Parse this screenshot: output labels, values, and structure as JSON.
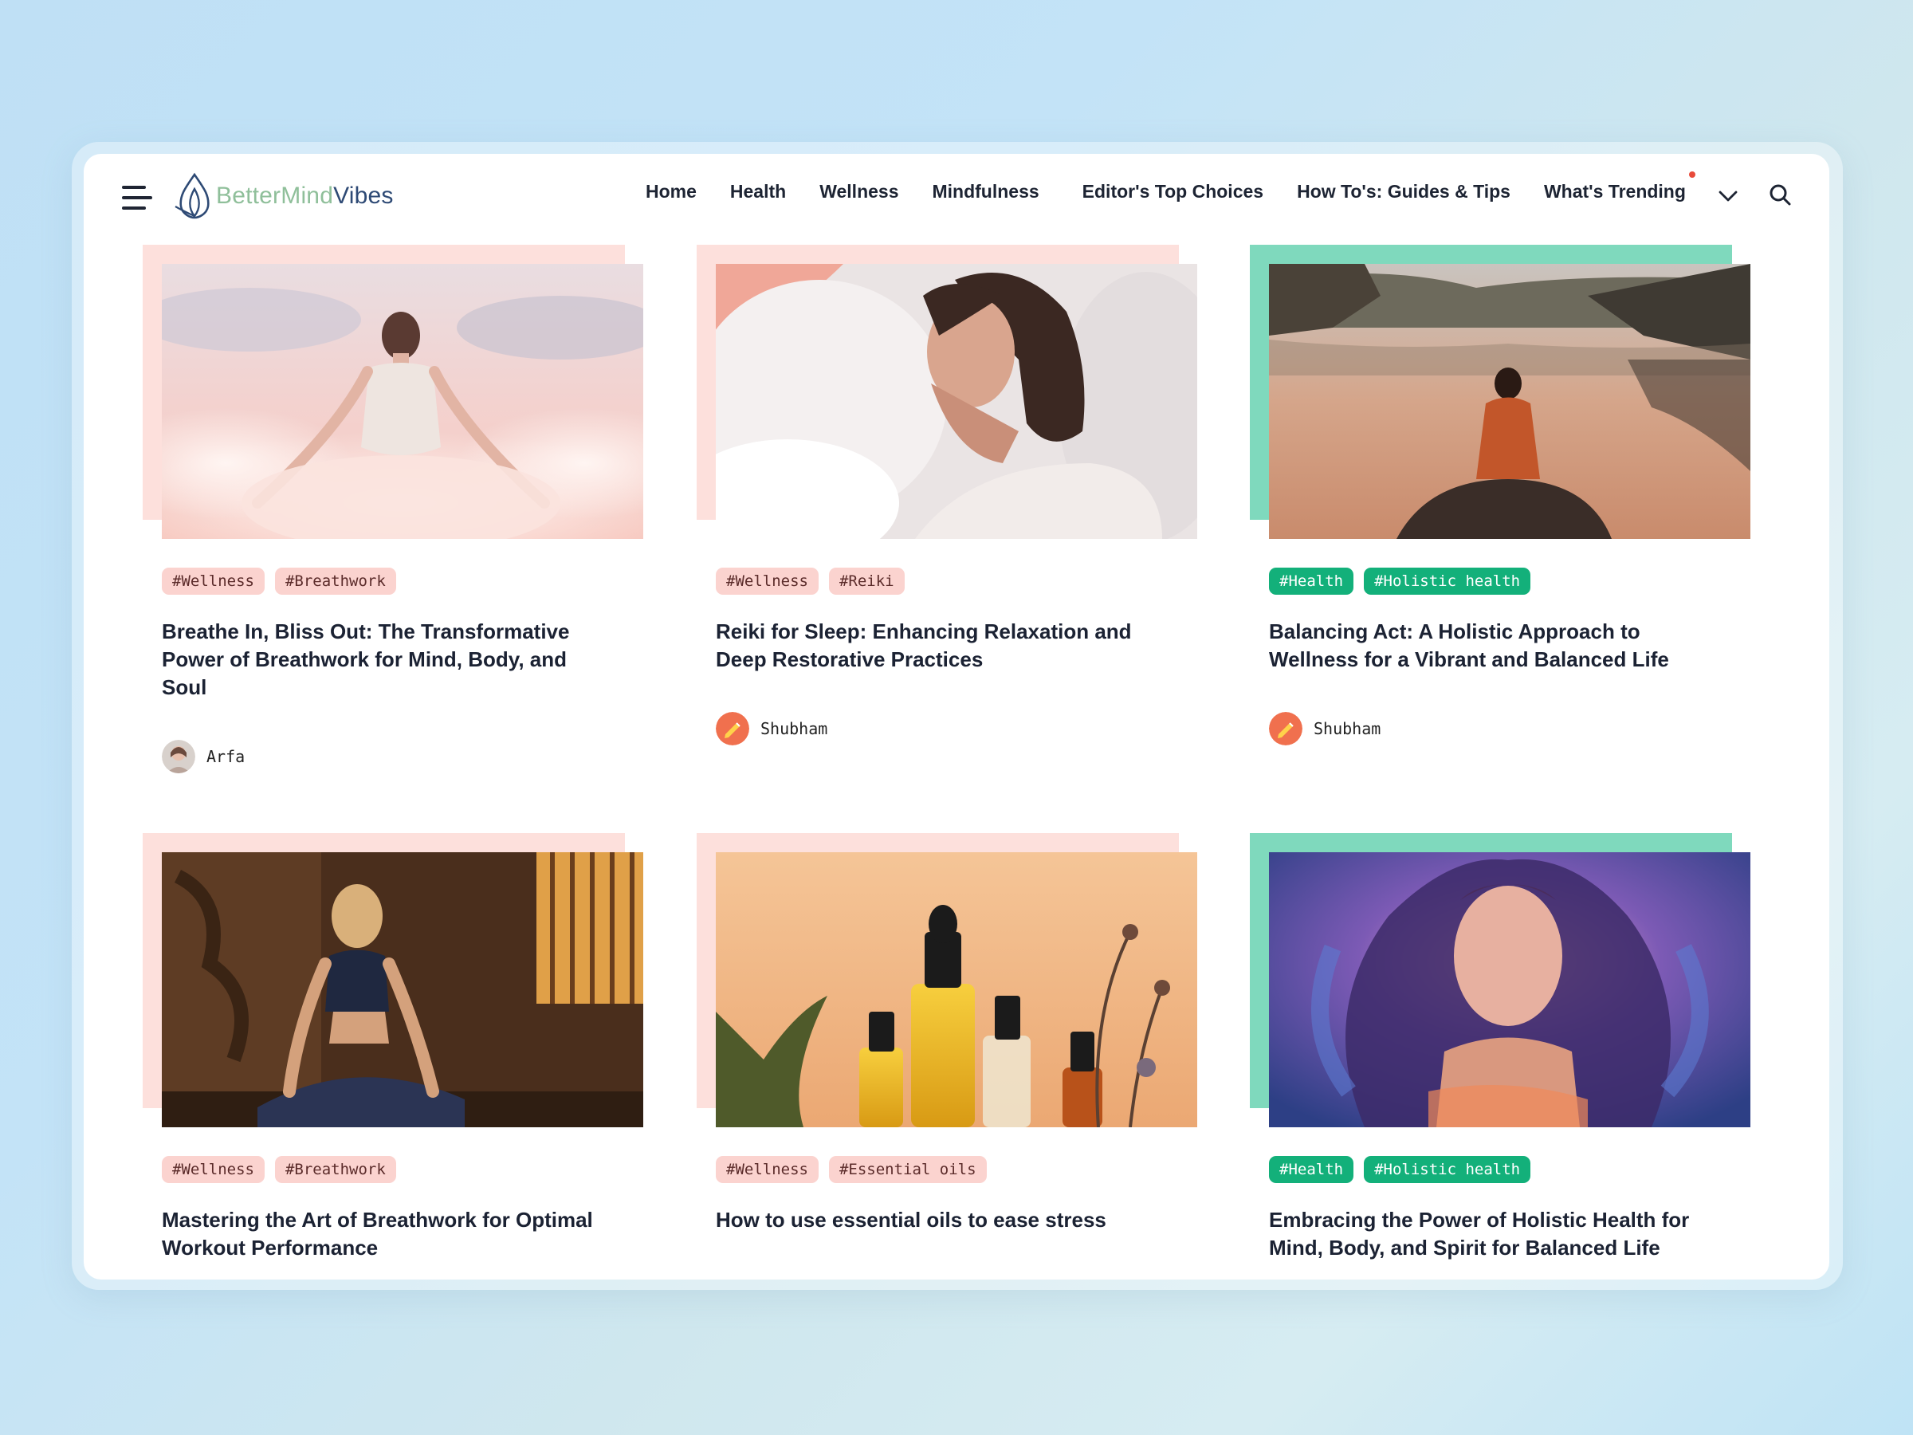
{
  "brand": {
    "name_part1": "Better",
    "name_part2": "Mind",
    "name_part3": "Vibes"
  },
  "nav": {
    "items": [
      "Home",
      "Health",
      "Wellness",
      "Mindfulness",
      "Editor's Top Choices",
      "How To's: Guides & Tips",
      "What's Trending"
    ],
    "icons": [
      "hamburger-icon",
      "chevron-down-icon",
      "search-icon"
    ]
  },
  "colors": {
    "pink_tag": "#fbd3cf",
    "green_tag": "#13b07a",
    "pink_frame": "#fde0dc",
    "green_frame": "#7fd9bd"
  },
  "cards": [
    {
      "tags": [
        "#Wellness",
        "#Breathwork"
      ],
      "title": "Breathe In, Bliss Out: The Transformative Power of Breathwork for Mind, Body, and Soul",
      "author": "Arfa"
    },
    {
      "tags": [
        "#Wellness",
        "#Reiki"
      ],
      "title": "Reiki for Sleep: Enhancing Relaxation and Deep Restorative Practices",
      "author": "Shubham"
    },
    {
      "tags": [
        "#Health",
        "#Holistic health"
      ],
      "title": "Balancing Act: A Holistic Approach to Wellness for a Vibrant and Balanced Life",
      "author": "Shubham"
    },
    {
      "tags": [
        "#Wellness",
        "#Breathwork"
      ],
      "title": "Mastering the Art of Breathwork for Optimal Workout Performance"
    },
    {
      "tags": [
        "#Wellness",
        "#Essential oils"
      ],
      "title": "How to use essential oils to ease stress"
    },
    {
      "tags": [
        "#Health",
        "#Holistic health"
      ],
      "title": "Embracing the Power of Holistic Health for Mind, Body, and Spirit for Balanced Life"
    }
  ]
}
